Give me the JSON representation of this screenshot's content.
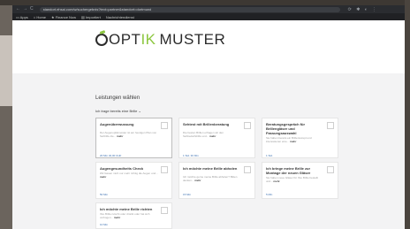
{
  "browser": {
    "url": "standort.ehsai.com/w/suchergebnis?text=partner&standort=dortmund",
    "nav_back": "←",
    "nav_forward": "→",
    "nav_reload": "C",
    "extensions": "⟳ ✱ ◐ ⋮",
    "bookmarks": [
      "▭ Apps",
      "⌂ Home",
      "★ Finance Now",
      "▤ Importiert",
      "Nachrichtendienst"
    ]
  },
  "brand": {
    "logo_prefix": "OPT",
    "logo_accent": "IK",
    "logo_rest": "MUSTER",
    "accent_color": "#8cc63f"
  },
  "services": {
    "heading": "Leistungen wählen",
    "filter_label": "Ich trage bereits eine Brille ⌄",
    "cards": [
      {
        "title": "Augenüberwussung",
        "desc": "Der Augenoptikmeister ist am heutigen Plan von Sehhilfe die...",
        "more": "mehr",
        "meta": "20 Min   32,00 CHF"
      },
      {
        "title": "Sehtest mit Brillenberatung",
        "desc": "Die besten Brillen erfragen wir den Sehbedarfshilfe und...",
        "more": "mehr",
        "meta": "1 Std. 30 Min"
      },
      {
        "title": "Beratungsgespräch für Brillengläser und Fassungsauswahl",
        "desc": "Sie haben bereits ein Brillenrezept und interessieren eine...",
        "more": "mehr",
        "meta": "1 Std."
      },
      {
        "title": "Augengesundheits Check",
        "desc": "Wir fassen mich nur mehr richtig die Augen und...",
        "more": "mehr",
        "meta": "50 Min"
      },
      {
        "title": "Ich möchte meine Brille abholen",
        "desc": "Ich möchte gerne meine Brille abholen? Bitten denken...",
        "more": "mehr",
        "meta": "15 Min"
      },
      {
        "title": "Ich bringe meine Brille zur Montage der neuen Gläser",
        "desc": "Sie haben neue Gläser für Ihre Brille bestellt und...",
        "more": "mehr",
        "meta": "5 Min"
      },
      {
        "title": "Ich möchte meine Brille richten",
        "desc": "Ihre Brille rutscht oder drückt oder hat sich verbogen...",
        "more": "mehr",
        "meta": "10 Min"
      }
    ]
  }
}
